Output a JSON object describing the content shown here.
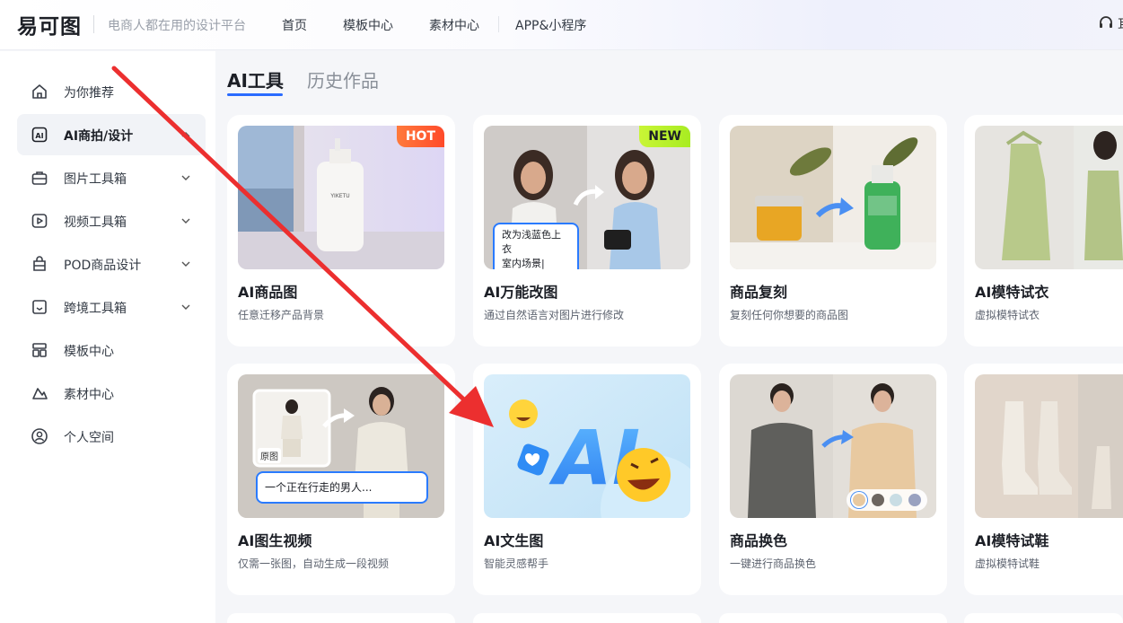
{
  "header": {
    "logo_text": "易可图",
    "slogan": "电商人都在用的设计平台",
    "nav": [
      "首页",
      "模板中心",
      "素材中心",
      "APP&小程序"
    ],
    "right_cut_text": "耳"
  },
  "sidebar": {
    "items": [
      {
        "label": "为你推荐",
        "icon": "home-icon",
        "chevron": false
      },
      {
        "label": "AI商拍/设计",
        "icon": "ai-icon",
        "chevron": true,
        "active": true
      },
      {
        "label": "图片工具箱",
        "icon": "toolbox-icon",
        "chevron": true
      },
      {
        "label": "视频工具箱",
        "icon": "video-play-icon",
        "chevron": true
      },
      {
        "label": "POD商品设计",
        "icon": "print-bag-icon",
        "chevron": true
      },
      {
        "label": "跨境工具箱",
        "icon": "cross-border-icon",
        "chevron": true
      },
      {
        "label": "模板中心",
        "icon": "template-grid-icon",
        "chevron": false
      },
      {
        "label": "素材中心",
        "icon": "shapes-icon",
        "chevron": false
      },
      {
        "label": "个人空间",
        "icon": "user-icon",
        "chevron": false
      }
    ]
  },
  "tabs": {
    "active": "AI工具",
    "inactive": "历史作品"
  },
  "cards": [
    {
      "title": "AI商品图",
      "subtitle": "任意迁移产品背景",
      "badge": "HOT",
      "product_label": "YIKETU"
    },
    {
      "title": "AI万能改图",
      "subtitle": "通过自然语言对图片进行修改",
      "badge": "NEW",
      "bubble": [
        "改为浅蓝色上衣",
        "室内场景|"
      ]
    },
    {
      "title": "商品复刻",
      "subtitle": "复刻任何你想要的商品图"
    },
    {
      "title": "AI模特试衣",
      "subtitle": "虚拟模特试衣"
    },
    {
      "title": "AI图生视频",
      "subtitle": "仅需一张图，自动生成一段视频",
      "orig_tag": "原图",
      "bubble": [
        "一个正在行走的男人..."
      ]
    },
    {
      "title": "AI文生图",
      "subtitle": "智能灵感帮手",
      "art_text": "AI"
    },
    {
      "title": "商品换色",
      "subtitle": "一键进行商品换色",
      "swatches": [
        "#e8c9a0",
        "#6d6660",
        "#c9dde4",
        "#9aa2c0"
      ]
    },
    {
      "title": "AI模特试鞋",
      "subtitle": "虚拟模特试鞋"
    }
  ],
  "colors": {
    "accent": "#2a6bff",
    "annotation_arrow": "#ec2f2f",
    "hot": "#ff5330",
    "new": "#b6ef2c"
  }
}
